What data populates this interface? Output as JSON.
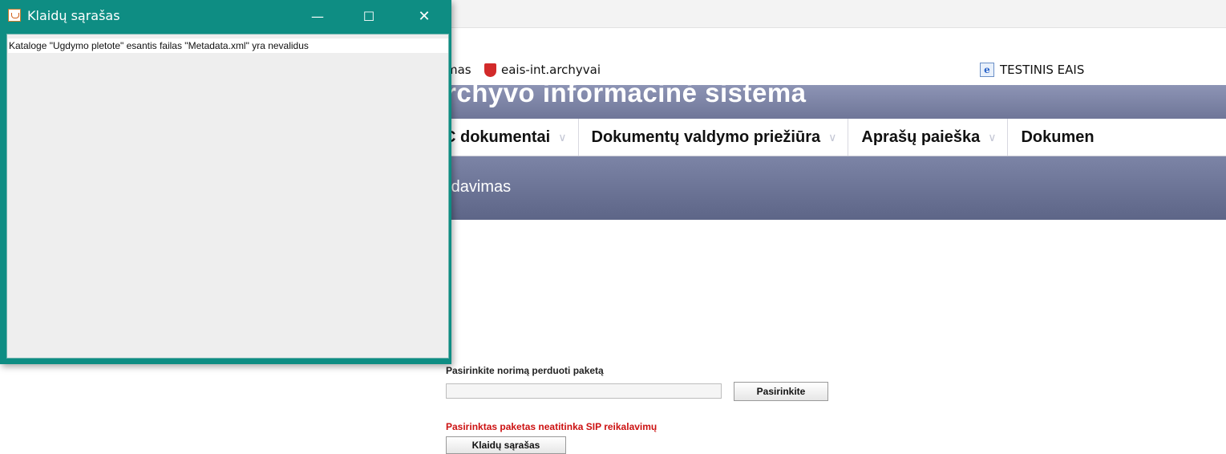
{
  "browser": {
    "favorites": {
      "item1_label": "mas",
      "item2_label": "eais-int.archyvai",
      "item3_label": "TESTINIS EAIS"
    }
  },
  "site": {
    "title": "rchyvo informacinė sistema",
    "nav": [
      {
        "label": "C dokumentai"
      },
      {
        "label": "Dokumentų valdymo priežiūra"
      },
      {
        "label": "Aprašų paieška"
      },
      {
        "label": "Dokumen"
      }
    ],
    "subheader": "rdavimas",
    "form": {
      "label": "Pasirinkite norimą perduoti paketą",
      "file_value": "",
      "choose_button": "Pasirinkite",
      "error": "Pasirinktas paketas neatitinka SIP reikalavimų",
      "errors_button": "Klaidų sąrašas"
    }
  },
  "dialog": {
    "title": "Klaidų sąrašas",
    "minimize": "—",
    "maximize": "☐",
    "close": "✕",
    "items": [
      "Kataloge \"Ugdymo pletote\" esantis failas \"Metadata.xml\" yra nevalidus"
    ]
  },
  "colors": {
    "dialog_frame": "#0e8d83",
    "header": "#7c84a6",
    "error": "#cc1111"
  }
}
